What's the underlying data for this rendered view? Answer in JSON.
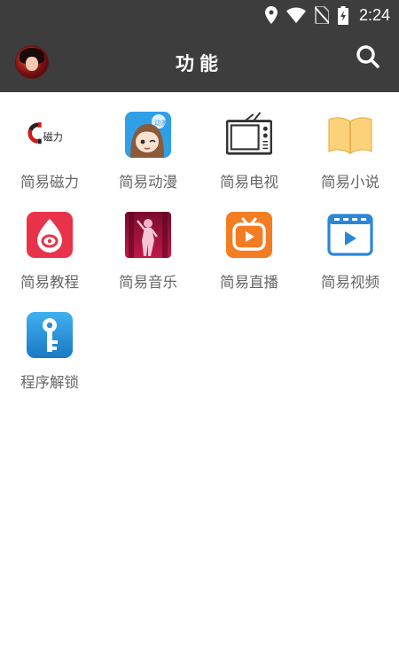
{
  "status_bar": {
    "time": "2:24",
    "icons": [
      "location-icon",
      "wifi-icon",
      "no-sim-icon",
      "battery-charging-icon"
    ]
  },
  "app_bar": {
    "title": "功能",
    "avatar": "avatar",
    "search_icon": "search-icon"
  },
  "colors": {
    "app_bar": "#3d3d3d",
    "label": "#666666",
    "background": "#ffffff"
  },
  "features": [
    {
      "label": "简易磁力",
      "icon": "magnet-icon",
      "icon_text": "磁力"
    },
    {
      "label": "简易动漫",
      "icon": "anime-girl-icon",
      "icon_text": "动漫"
    },
    {
      "label": "简易电视",
      "icon": "tv-icon"
    },
    {
      "label": "简易小说",
      "icon": "book-icon"
    },
    {
      "label": "简易教程",
      "icon": "tutorial-icon"
    },
    {
      "label": "简易音乐",
      "icon": "music-singer-icon"
    },
    {
      "label": "简易直播",
      "icon": "live-tv-icon"
    },
    {
      "label": "简易视频",
      "icon": "video-player-icon"
    },
    {
      "label": "程序解锁",
      "icon": "key-icon"
    }
  ]
}
